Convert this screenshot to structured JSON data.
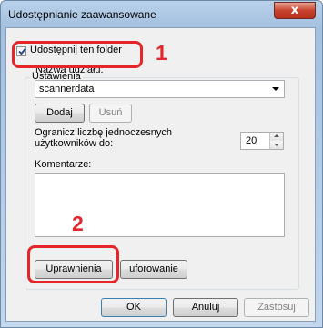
{
  "window": {
    "title": "Udostępnianie zaawansowane",
    "close_symbol": "x"
  },
  "share": {
    "checkbox_label": "Udostępnij ten folder",
    "checked": true
  },
  "settings": {
    "group_label": "Ustawienia",
    "share_name_label": "Nazwa udziału:",
    "share_name_value": "scannerdata",
    "add_label": "Dodaj",
    "remove_label": "Usuń",
    "limit_label": "Ogranicz liczbę jednoczesnych użytkowników do:",
    "limit_value": "20",
    "comments_label": "Komentarze:",
    "comments_value": "",
    "permissions_label": "Uprawnienia",
    "caching_label": "uforowanie"
  },
  "footer": {
    "ok_label": "OK",
    "cancel_label": "Anuluj",
    "apply_label": "Zastosuj"
  },
  "annotations": {
    "marker_1": "1",
    "marker_2": "2",
    "highlight_color": "#e5252a"
  }
}
